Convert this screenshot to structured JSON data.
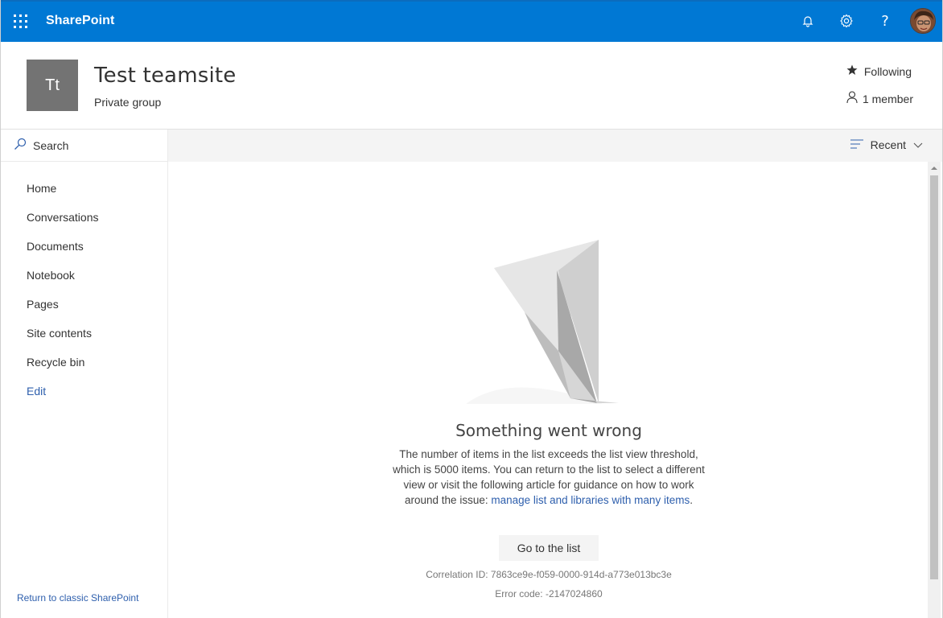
{
  "suitebar": {
    "brand": "SharePoint",
    "color": "#0078d4",
    "icons": [
      "waffle-icon",
      "bell-icon",
      "gear-icon",
      "help-icon",
      "user-avatar"
    ]
  },
  "site": {
    "logo_text": "Tt",
    "title": "Test teamsite",
    "subtitle": "Private group",
    "following_label": "Following",
    "members_label": "1 member"
  },
  "nav": {
    "search_label": "Search",
    "items": [
      {
        "label": "Home"
      },
      {
        "label": "Conversations"
      },
      {
        "label": "Documents"
      },
      {
        "label": "Notebook"
      },
      {
        "label": "Pages"
      },
      {
        "label": "Site contents"
      },
      {
        "label": "Recycle bin"
      },
      {
        "label": "Edit"
      }
    ],
    "classic_link": "Return to classic SharePoint"
  },
  "cmdbar": {
    "sort_label": "Recent"
  },
  "error": {
    "title": "Something went wrong",
    "message": "The number of items in the list exceeds the list view threshold, which is 5000 items. You can return to the list to select a different view or visit the following article for guidance on how to work around the issue: ",
    "link_text": "manage list and libraries with many items",
    "message_end": ".",
    "button_label": "Go to the list",
    "correlation": "Correlation ID: 7863ce9e-f059-0000-914d-a773e013bc3e",
    "error_code": "Error code: -2147024860"
  },
  "colors": {
    "accent": "#0078d4",
    "link": "#2e5fad",
    "logo_bg": "#737373"
  }
}
